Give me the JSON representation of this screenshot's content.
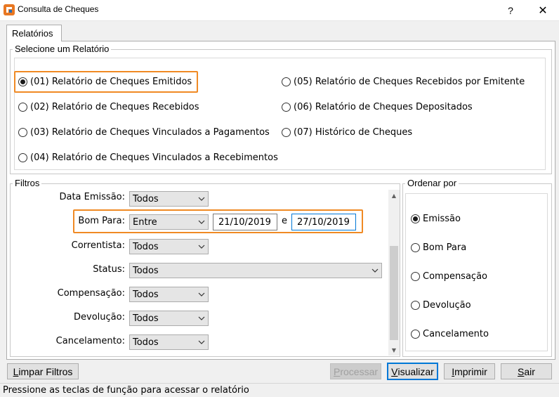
{
  "window": {
    "title": "Consulta de Cheques",
    "help_label": "?",
    "close_label": "✕"
  },
  "tab": {
    "label": "Relatórios"
  },
  "report_group": {
    "legend": "Selecione um Relatório",
    "options": [
      {
        "label": "(01) Relatório de Cheques Emitidos",
        "checked": true
      },
      {
        "label": "(02) Relatório de Cheques Recebidos",
        "checked": false
      },
      {
        "label": "(03) Relatório de Cheques Vinculados a Pagamentos",
        "checked": false
      },
      {
        "label": "(04) Relatório de Cheques Vinculados a Recebimentos",
        "checked": false
      },
      {
        "label": "(05) Relatório de Cheques Recebidos por Emitente",
        "checked": false
      },
      {
        "label": "(06) Relatório de Cheques Depositados",
        "checked": false
      },
      {
        "label": "(07) Histórico de Cheques",
        "checked": false
      }
    ]
  },
  "filters": {
    "legend": "Filtros",
    "data_emissao": {
      "label": "Data Emissão:",
      "value": "Todos"
    },
    "bom_para": {
      "label": "Bom Para:",
      "value": "Entre",
      "date_from": "21/10/2019",
      "connector": "e",
      "date_to": "27/10/2019"
    },
    "correntista": {
      "label": "Correntista:",
      "value": "Todos"
    },
    "status": {
      "label": "Status:",
      "value": "Todos"
    },
    "compensacao": {
      "label": "Compensação:",
      "value": "Todos"
    },
    "devolucao": {
      "label": "Devolução:",
      "value": "Todos"
    },
    "cancelamento": {
      "label": "Cancelamento:",
      "value": "Todos"
    }
  },
  "order": {
    "legend": "Ordenar por",
    "options": [
      {
        "label": "Emissão",
        "checked": true
      },
      {
        "label": "Bom Para",
        "checked": false
      },
      {
        "label": "Compensação",
        "checked": false
      },
      {
        "label": "Devolução",
        "checked": false
      },
      {
        "label": "Cancelamento",
        "checked": false
      }
    ]
  },
  "buttons": {
    "limpar_first": "L",
    "limpar_rest": "impar Filtros",
    "processar_first": "P",
    "processar_rest": "rocessar",
    "visualizar_first": "V",
    "visualizar_rest": "isualizar",
    "imprimir_first": "I",
    "imprimir_rest": "mprimir",
    "sair_first": "S",
    "sair_rest": "air"
  },
  "status_bar": {
    "text": "Pressione as teclas de função para acessar o relatório"
  },
  "colors": {
    "highlight": "#f08a24",
    "focus": "#0078d7"
  }
}
